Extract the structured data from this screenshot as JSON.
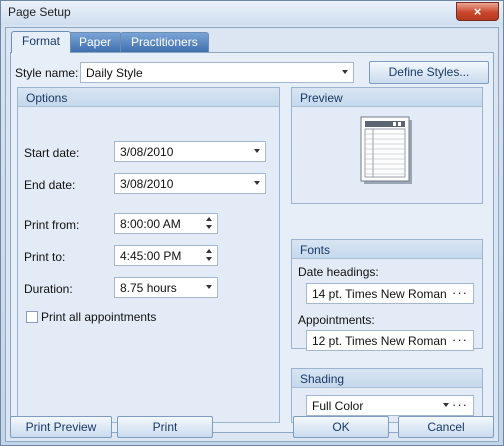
{
  "window": {
    "title": "Page Setup",
    "close_glyph": "×"
  },
  "tabs": [
    {
      "label": "Format",
      "active": true
    },
    {
      "label": "Paper",
      "active": false
    },
    {
      "label": "Practitioners",
      "active": false
    }
  ],
  "style": {
    "label": "Style name:",
    "value": "Daily Style",
    "define_button": "Define Styles..."
  },
  "options": {
    "header": "Options",
    "start_date": {
      "label": "Start date:",
      "value": "3/08/2010"
    },
    "end_date": {
      "label": "End date:",
      "value": "3/08/2010"
    },
    "print_from": {
      "label": "Print from:",
      "value": "8:00:00 AM"
    },
    "print_to": {
      "label": "Print to:",
      "value": "4:45:00 PM"
    },
    "duration": {
      "label": "Duration:",
      "value": "8.75 hours"
    },
    "print_all": {
      "label": "Print all appointments",
      "checked": false
    }
  },
  "preview": {
    "header": "Preview",
    "icon": "page-layout-icon"
  },
  "fonts": {
    "header": "Fonts",
    "date_headings": {
      "label": "Date headings:",
      "value": "14 pt. Times New Roman"
    },
    "appointments": {
      "label": "Appointments:",
      "value": "12 pt. Times New Roman"
    }
  },
  "shading": {
    "header": "Shading",
    "value": "Full Color"
  },
  "buttons": {
    "print_preview": "Print Preview",
    "print": "Print",
    "ok": "OK",
    "cancel": "Cancel"
  },
  "ellipsis": "···"
}
